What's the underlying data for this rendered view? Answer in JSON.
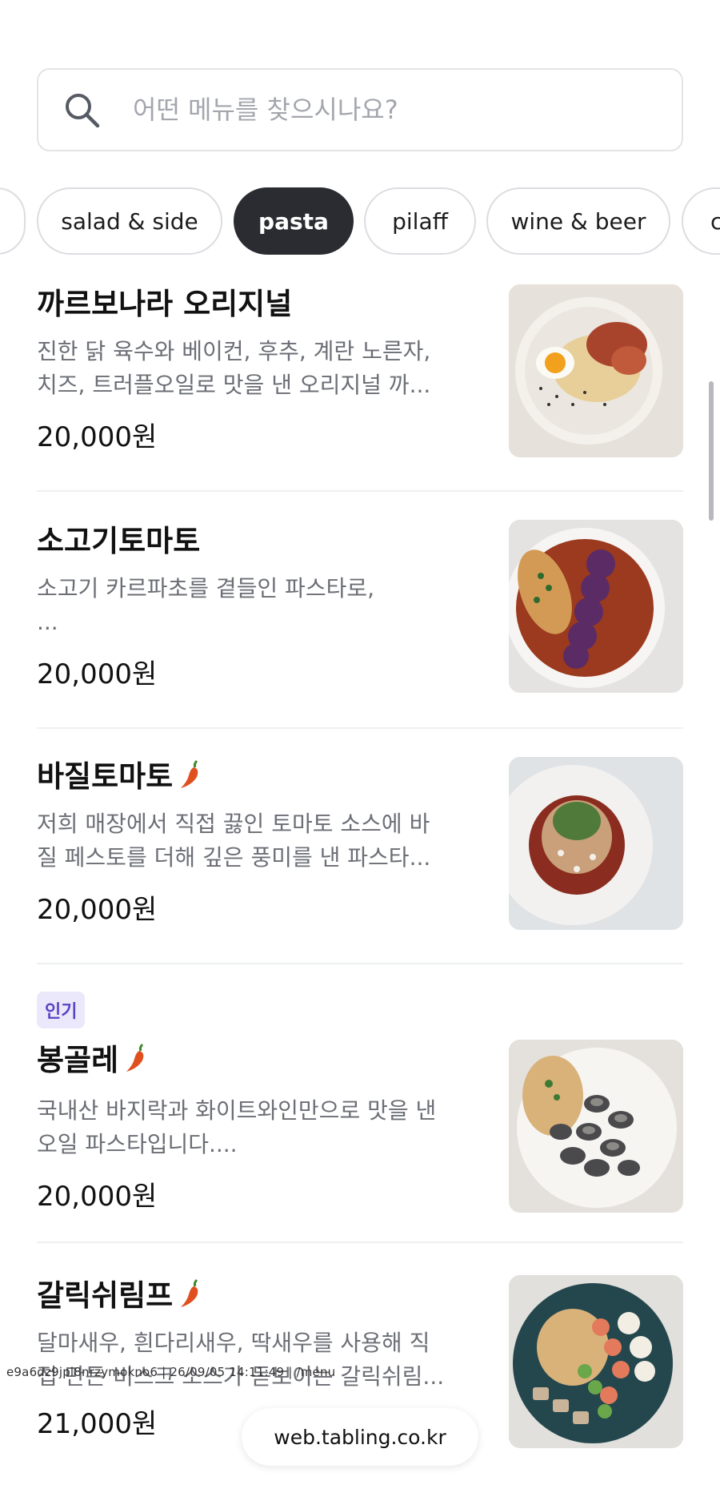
{
  "search": {
    "placeholder": "어떤 메뉴를 찾으시나요?",
    "icon": "search-icon"
  },
  "categories": [
    {
      "label": "",
      "active": false
    },
    {
      "label": "salad & side",
      "active": false
    },
    {
      "label": "pasta",
      "active": true
    },
    {
      "label": "pilaff",
      "active": false
    },
    {
      "label": "wine & beer",
      "active": false
    },
    {
      "label": "c",
      "active": false
    }
  ],
  "menu_items": [
    {
      "name": "까르보나라 오리지널",
      "spicy": false,
      "badge": "",
      "description_line1": "진한 닭 육수와 베이컨, 후추, 계란 노른자,",
      "description_line2": "치즈, 트러플오일로 맛을 낸 오리지널 까...",
      "price": "20,000원"
    },
    {
      "name": "소고기토마토",
      "spicy": false,
      "badge": "",
      "description_line1": "소고기 카르파초를 곁들인 파스타로,",
      "description_line2": " ...",
      "price": "20,000원"
    },
    {
      "name": "바질토마토",
      "spicy": true,
      "badge": "",
      "description_line1": "저희 매장에서 직접 끓인 토마토 소스에 바",
      "description_line2": "질 페스토를 더해 깊은 풍미를 낸 파스타...",
      "price": "20,000원"
    },
    {
      "name": "봉골레",
      "spicy": true,
      "badge": "인기",
      "description_line1": "국내산 바지락과 화이트와인만으로 맛을 낸",
      "description_line2": "오일 파스타입니다....",
      "price": "20,000원"
    },
    {
      "name": "갈릭쉬림프",
      "spicy": true,
      "badge": "",
      "description_line1": "달마새우, 흰다리새우, 딱새우를 사용해 직",
      "description_line2": "접 만든 비스크 소스가 돋보이는 갈릭쉬림...",
      "price": "21,000원"
    }
  ],
  "overlay": {
    "watermark": "e9a6dz9jpl8nrzymokno6 | 26/09/05 14:11:49 | /menu",
    "url": "web.tabling.co.kr"
  },
  "colors": {
    "active_chip": "#2a2c31",
    "badge_bg": "#ece8fb",
    "badge_text": "#5a43c4",
    "chili": "#e0501f"
  }
}
